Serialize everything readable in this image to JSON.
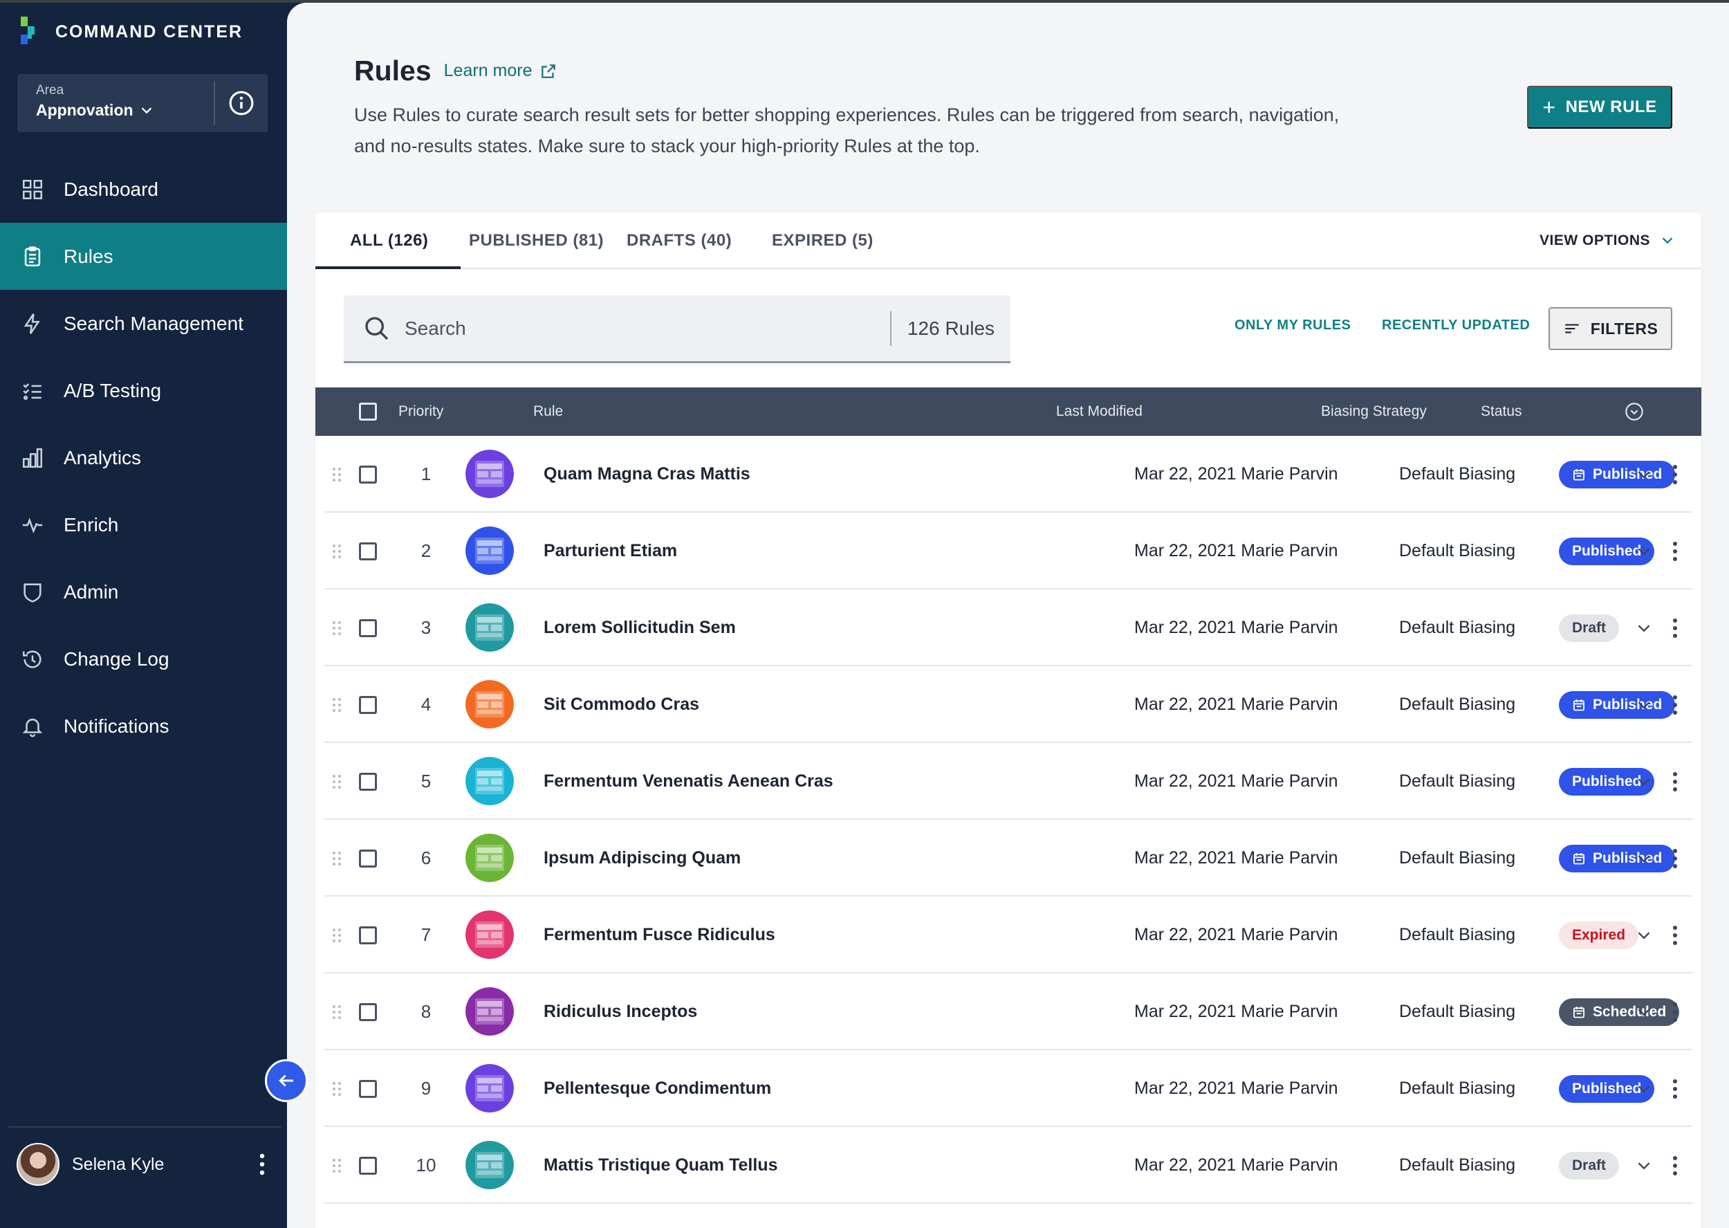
{
  "brand": {
    "name": "COMMAND CENTER",
    "logo_colors": [
      "#7ad13b",
      "#1fb7c1",
      "#2b64e3"
    ]
  },
  "area": {
    "label": "Area",
    "value": "Appnovation"
  },
  "nav": {
    "items": [
      {
        "label": "Dashboard",
        "icon": "dashboard-icon",
        "active": false
      },
      {
        "label": "Rules",
        "icon": "clipboard-icon",
        "active": true
      },
      {
        "label": "Search Management",
        "icon": "lightning-icon",
        "active": false
      },
      {
        "label": "A/B Testing",
        "icon": "checklist-icon",
        "active": false
      },
      {
        "label": "Analytics",
        "icon": "bar-chart-icon",
        "active": false
      },
      {
        "label": "Enrich",
        "icon": "pulse-icon",
        "active": false
      },
      {
        "label": "Admin",
        "icon": "shield-icon",
        "active": false
      },
      {
        "label": "Change Log",
        "icon": "history-icon",
        "active": false
      },
      {
        "label": "Notifications",
        "icon": "bell-icon",
        "active": false
      }
    ]
  },
  "user": {
    "name": "Selena Kyle"
  },
  "page": {
    "title": "Rules",
    "learn_more": "Learn more",
    "description": "Use Rules to curate search result sets for better shopping experiences. Rules can be triggered from search, navigation, and no-results states. Make sure to stack your high-priority Rules at the top.",
    "new_rule": "NEW RULE"
  },
  "tabs": [
    {
      "label": "ALL (126)",
      "active": true
    },
    {
      "label": "PUBLISHED (81)",
      "active": false
    },
    {
      "label": "DRAFTS (40)",
      "active": false
    },
    {
      "label": "EXPIRED (5)",
      "active": false
    }
  ],
  "view_options": "VIEW OPTIONS",
  "search": {
    "placeholder": "Search",
    "count": "126 Rules"
  },
  "toolbar": {
    "only_my_rules": "ONLY MY RULES",
    "recently_updated": "RECENTLY UPDATED",
    "filters": "FILTERS"
  },
  "table": {
    "headers": {
      "priority": "Priority",
      "rule": "Rule",
      "last_modified": "Last Modified",
      "biasing": "Biasing Strategy",
      "status": "Status"
    },
    "rows": [
      {
        "priority": "1",
        "name": "Quam Magna Cras Mattis",
        "modified": "Mar 22, 2021 Marie Parvin",
        "biasing": "Default Biasing",
        "status": "Published",
        "status_type": "published",
        "calendar": true,
        "thumb": "#6b3fe0"
      },
      {
        "priority": "2",
        "name": "Parturient Etiam",
        "modified": "Mar 22, 2021 Marie Parvin",
        "biasing": "Default Biasing",
        "status": "Published",
        "status_type": "published",
        "calendar": false,
        "thumb": "#2f52e8"
      },
      {
        "priority": "3",
        "name": "Lorem Sollicitudin Sem",
        "modified": "Mar 22, 2021 Marie Parvin",
        "biasing": "Default Biasing",
        "status": "Draft",
        "status_type": "draft",
        "calendar": false,
        "thumb": "#1f9aa0"
      },
      {
        "priority": "4",
        "name": "Sit Commodo Cras",
        "modified": "Mar 22, 2021 Marie Parvin",
        "biasing": "Default Biasing",
        "status": "Published",
        "status_type": "published",
        "calendar": true,
        "thumb": "#f26a21"
      },
      {
        "priority": "5",
        "name": "Fermentum Venenatis Aenean Cras",
        "modified": "Mar 22, 2021 Marie Parvin",
        "biasing": "Default Biasing",
        "status": "Published",
        "status_type": "published",
        "calendar": false,
        "thumb": "#19b3d3"
      },
      {
        "priority": "6",
        "name": "Ipsum Adipiscing Quam",
        "modified": "Mar 22, 2021 Marie Parvin",
        "biasing": "Default Biasing",
        "status": "Published",
        "status_type": "published",
        "calendar": true,
        "thumb": "#6bb534"
      },
      {
        "priority": "7",
        "name": "Fermentum Fusce Ridiculus",
        "modified": "Mar 22, 2021 Marie Parvin",
        "biasing": "Default Biasing",
        "status": "Expired",
        "status_type": "expired",
        "calendar": false,
        "thumb": "#e2346e"
      },
      {
        "priority": "8",
        "name": "Ridiculus Inceptos",
        "modified": "Mar 22, 2021 Marie Parvin",
        "biasing": "Default Biasing",
        "status": "Scheduled",
        "status_type": "scheduled",
        "calendar": true,
        "thumb": "#8a2ba8"
      },
      {
        "priority": "9",
        "name": "Pellentesque Condimentum",
        "modified": "Mar 22, 2021 Marie Parvin",
        "biasing": "Default Biasing",
        "status": "Published",
        "status_type": "published",
        "calendar": false,
        "thumb": "#6b3fe0"
      },
      {
        "priority": "10",
        "name": "Mattis Tristique Quam Tellus",
        "modified": "Mar 22, 2021 Marie Parvin",
        "biasing": "Default Biasing",
        "status": "Draft",
        "status_type": "draft",
        "calendar": false,
        "thumb": "#1f9aa0"
      }
    ]
  }
}
